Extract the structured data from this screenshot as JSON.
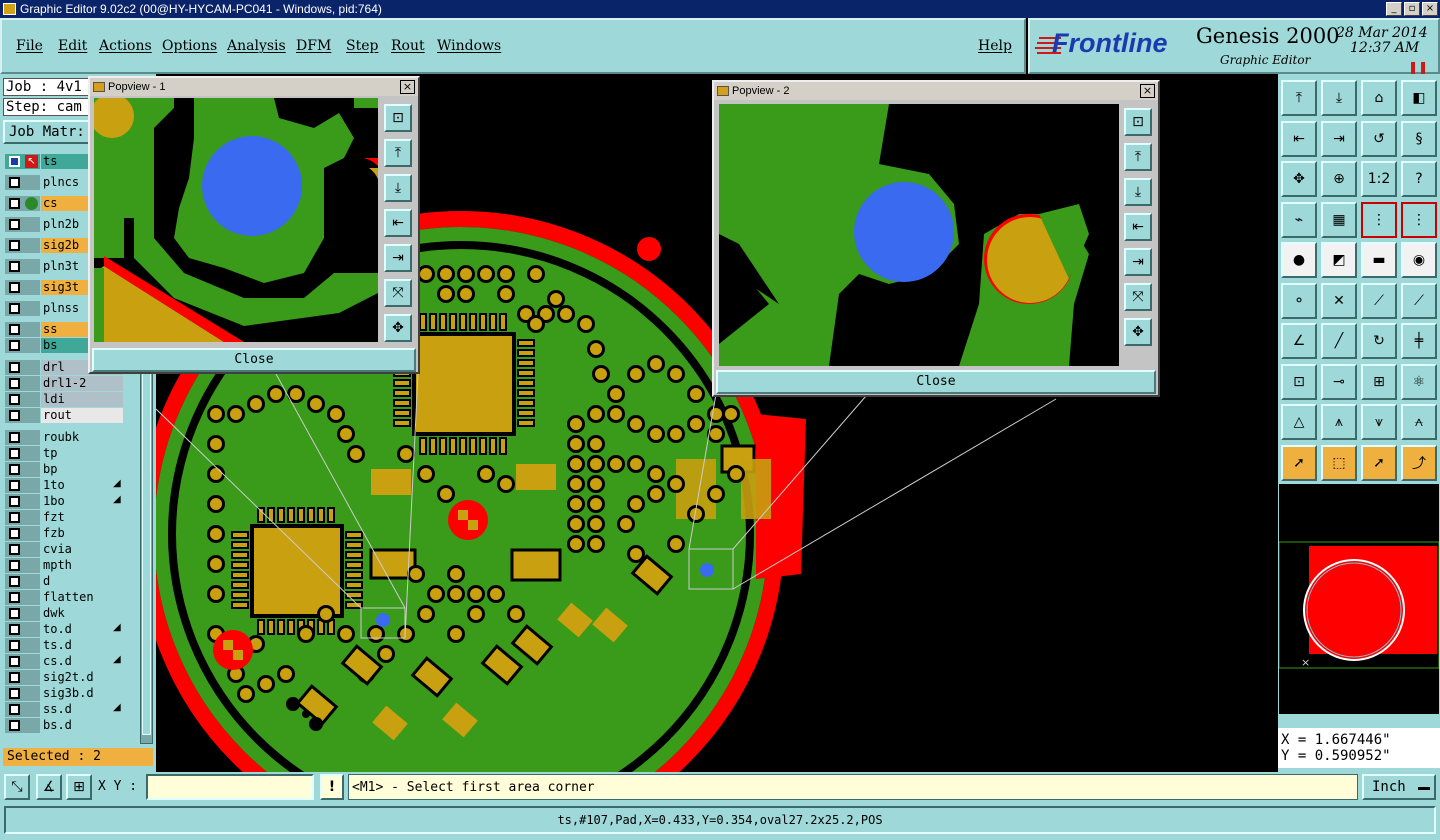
{
  "window": {
    "title": "Graphic Editor 9.02c2 (00@HY-HYCAM-PC041 - Windows, pid:764)"
  },
  "menu": {
    "items": [
      "File",
      "Edit",
      "Actions",
      "Options",
      "Analysis",
      "DFM",
      "Step",
      "Rout",
      "Windows"
    ],
    "help": "Help"
  },
  "brand": {
    "logo": "Frontline",
    "product": "Genesis 2000",
    "subtitle": "Graphic Editor",
    "date": "28 Mar 2014",
    "time": "12:37 AM"
  },
  "job": {
    "job_label": "Job : 4v1",
    "step_label": "Step: cam",
    "matrix_button": "Job Matr:"
  },
  "layers": [
    {
      "name": "ts",
      "color": "#40a898",
      "work": true
    },
    {
      "name": "plncs",
      "color": "#9ed8d8"
    },
    {
      "name": "cs",
      "color": "#f0b040",
      "dot": "#2a8a2a"
    },
    {
      "name": "pln2b",
      "color": "#9ed8d8"
    },
    {
      "name": "sig2b",
      "color": "#f0b040"
    },
    {
      "name": "pln3t",
      "color": "#9ed8d8"
    },
    {
      "name": "sig3t",
      "color": "#f0b040"
    },
    {
      "name": "plnss",
      "color": "#9ed8d8"
    },
    {
      "name": "ss",
      "color": "#f0b040"
    },
    {
      "name": "bs",
      "color": "#40a898"
    },
    {
      "name": "drl",
      "color": "#b0c0c8"
    },
    {
      "name": "drl1-2",
      "color": "#b0c0c8"
    },
    {
      "name": "ldi",
      "color": "#b0c0c8"
    },
    {
      "name": "rout",
      "color": "#e8e8e8"
    },
    {
      "name": "roubk",
      "color": "#9ed8d8"
    },
    {
      "name": "tp",
      "color": "#9ed8d8"
    },
    {
      "name": "bp",
      "color": "#9ed8d8"
    },
    {
      "name": "1to",
      "color": "#9ed8d8",
      "mark": true
    },
    {
      "name": "1bo",
      "color": "#9ed8d8",
      "mark": true
    },
    {
      "name": "fzt",
      "color": "#9ed8d8"
    },
    {
      "name": "fzb",
      "color": "#9ed8d8"
    },
    {
      "name": "cvia",
      "color": "#9ed8d8"
    },
    {
      "name": "mpth",
      "color": "#9ed8d8"
    },
    {
      "name": "d",
      "color": "#9ed8d8"
    },
    {
      "name": "flatten",
      "color": "#9ed8d8"
    },
    {
      "name": "dwk",
      "color": "#9ed8d8"
    },
    {
      "name": "to.d",
      "color": "#9ed8d8",
      "mark": true
    },
    {
      "name": "ts.d",
      "color": "#9ed8d8"
    },
    {
      "name": "cs.d",
      "color": "#9ed8d8",
      "mark": true
    },
    {
      "name": "sig2t.d",
      "color": "#9ed8d8"
    },
    {
      "name": "sig3b.d",
      "color": "#9ed8d8"
    },
    {
      "name": "ss.d",
      "color": "#9ed8d8",
      "mark": true
    },
    {
      "name": "bs.d",
      "color": "#9ed8d8"
    }
  ],
  "selected": "Selected : 2",
  "popview1": {
    "title": "Popview - 1",
    "close": "Close"
  },
  "popview2": {
    "title": "Popview - 2",
    "close": "Close"
  },
  "coords": {
    "x": "X = 1.667446\"",
    "y": "Y = 0.590952\""
  },
  "bottom": {
    "xy_label": "X Y :",
    "xy_value": "",
    "prompt": "<M1> - Select first area corner",
    "units": "Inch"
  },
  "status": {
    "text": "ts,#107,Pad,X=0.433,Y=0.354,oval27.2x25.2,POS"
  },
  "colors": {
    "board": "#3a9a1a",
    "copper": "#c8a010",
    "highlight": "#ff0000",
    "via": "#3a6af0",
    "panel": "#9ed8d8"
  }
}
